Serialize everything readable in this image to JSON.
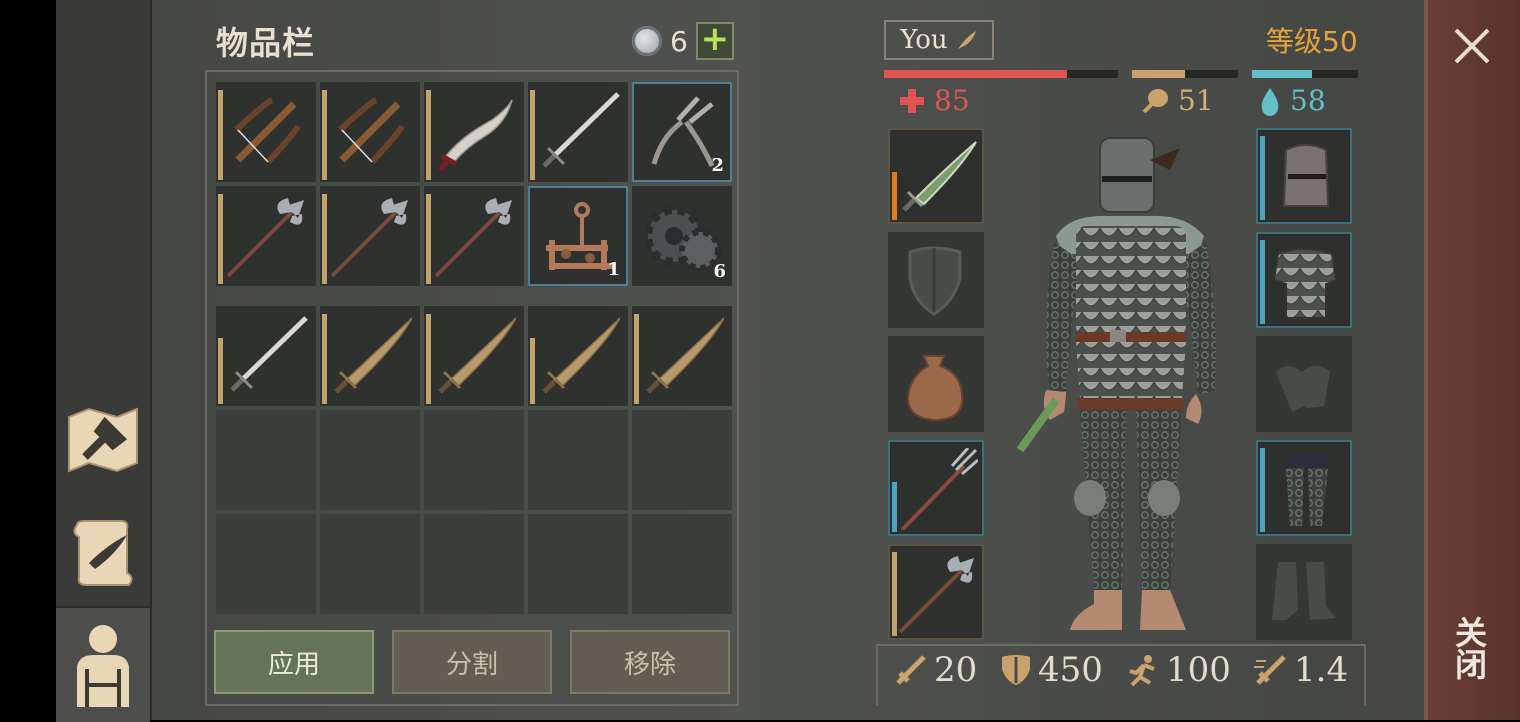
{
  "inventory": {
    "title": "物品栏",
    "currency_count": "6",
    "add_label": "+",
    "slots": [
      {
        "icon": "crossbow-icon",
        "count": ""
      },
      {
        "icon": "crossbow-icon",
        "count": ""
      },
      {
        "icon": "scimitar-icon",
        "count": ""
      },
      {
        "icon": "longsword-icon",
        "count": ""
      },
      {
        "icon": "pliers-icon",
        "count": "2"
      },
      {
        "icon": "halberd-icon",
        "count": ""
      },
      {
        "icon": "halberd-icon",
        "count": ""
      },
      {
        "icon": "halberd-icon",
        "count": ""
      },
      {
        "icon": "mechanism-icon",
        "count": "1"
      },
      {
        "icon": "gear-icon",
        "count": "6"
      },
      {
        "icon": "longsword-icon",
        "count": ""
      },
      {
        "icon": "bronze-sword-icon",
        "count": ""
      },
      {
        "icon": "bronze-sword-icon",
        "count": ""
      },
      {
        "icon": "bronze-sword-icon",
        "count": ""
      },
      {
        "icon": "bronze-sword-icon",
        "count": ""
      }
    ],
    "buttons": {
      "apply": "应用",
      "split": "分割",
      "remove": "移除"
    }
  },
  "character": {
    "name": "You",
    "level": "等级50",
    "health": "85",
    "food": "51",
    "water": "58",
    "health_fraction": 0.78,
    "food_fraction": 0.5,
    "water_fraction": 0.57,
    "colors": {
      "health": "#e05552",
      "food": "#c9a36b",
      "water": "#62c0c6",
      "level": "#e6a33a"
    },
    "left_slots": [
      "poisoned-dagger-icon",
      "shield-slot-icon",
      "sack-icon",
      "pitchfork-icon",
      "halberd-icon"
    ],
    "right_slots": [
      "great-helm-icon",
      "scale-armor-icon",
      "gloves-slot-icon",
      "chain-leggings-icon",
      "boots-slot-icon"
    ],
    "stats": {
      "attack": "20",
      "armor": "450",
      "speed": "100",
      "attack_speed": "1.4"
    }
  },
  "close_label": "关闭"
}
